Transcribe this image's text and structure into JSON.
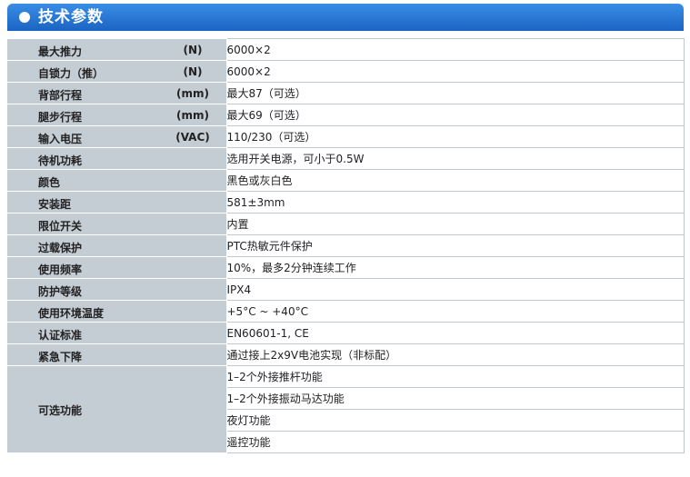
{
  "header": {
    "title": "技术参数"
  },
  "rows": [
    {
      "name": "最大推力",
      "unit": "(N)",
      "value": "6000×2"
    },
    {
      "name": "自锁力（推）",
      "unit": "(N)",
      "value": "6000×2"
    },
    {
      "name": "背部行程",
      "unit": "(mm)",
      "value": "最大87（可选）"
    },
    {
      "name": "腿步行程",
      "unit": "(mm)",
      "value": "最大69（可选）"
    },
    {
      "name": "输入电压",
      "unit": "(VAC)",
      "value": "110/230（可选）"
    },
    {
      "name": "待机功耗",
      "unit": "",
      "value": "选用开关电源，可小于0.5W"
    },
    {
      "name": "颜色",
      "unit": "",
      "value": "黑色或灰白色"
    },
    {
      "name": "安装距",
      "unit": "",
      "value": "581±3mm"
    },
    {
      "name": "限位开关",
      "unit": "",
      "value": "内置"
    },
    {
      "name": "过载保护",
      "unit": "",
      "value": "PTC热敏元件保护"
    },
    {
      "name": "使用频率",
      "unit": "",
      "value": "10%，最多2分钟连续工作"
    },
    {
      "name": "防护等级",
      "unit": "",
      "value": "IPX4"
    },
    {
      "name": "使用环境温度",
      "unit": "",
      "value": "+5°C ~ +40°C"
    },
    {
      "name": "认证标准",
      "unit": "",
      "value": "EN60601-1, CE"
    },
    {
      "name": "紧急下降",
      "unit": "",
      "value": "通过接上2x9V电池实现（非标配）"
    }
  ],
  "optional": {
    "name": "可选功能",
    "values": [
      "1–2个外接推杆功能",
      "1–2个外接振动马达功能",
      "夜灯功能",
      "遥控功能"
    ]
  }
}
